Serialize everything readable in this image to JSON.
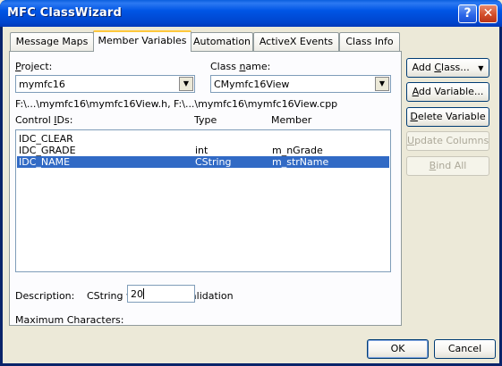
{
  "window": {
    "title": "MFC ClassWizard",
    "help_glyph": "?",
    "close_glyph": "✕"
  },
  "tabs": [
    {
      "label": "Message Maps"
    },
    {
      "label": "Member Variables"
    },
    {
      "label": "Automation"
    },
    {
      "label": "ActiveX Events"
    },
    {
      "label": "Class Info"
    }
  ],
  "project": {
    "label_pre": "",
    "label_u": "P",
    "label_post": "roject:",
    "value": "mymfc16"
  },
  "classname": {
    "label_pre": "Class ",
    "label_u": "n",
    "label_post": "ame:",
    "value": "CMymfc16View"
  },
  "files_path": "F:\\...\\mymfc16\\mymfc16View.h, F:\\...\\mymfc16\\mymfc16View.cpp",
  "list": {
    "headers": {
      "col1_pre": "Control ",
      "col1_u": "I",
      "col1_post": "Ds:",
      "col2": "Type",
      "col3": "Member"
    },
    "rows": [
      {
        "id": "IDC_CLEAR",
        "type": "",
        "member": ""
      },
      {
        "id": "IDC_GRADE",
        "type": "int",
        "member": "m_nGrade"
      },
      {
        "id": "IDC_NAME",
        "type": "CString",
        "member": "m_strName"
      }
    ],
    "selected_index": 2
  },
  "description": {
    "label": "Description:",
    "value": "CString with length validation"
  },
  "max_chars": {
    "label": "Maximum Characters:",
    "value": "20"
  },
  "buttons": {
    "add_class_pre": "Add ",
    "add_class_u": "C",
    "add_class_post": "lass...",
    "add_class_arrow": "▼",
    "add_variable_pre": "",
    "add_variable_u": "A",
    "add_variable_post": "dd Variable...",
    "delete_variable_pre": "",
    "delete_variable_u": "D",
    "delete_variable_post": "elete Variable",
    "update_columns_pre": "",
    "update_columns_u": "U",
    "update_columns_post": "pdate Columns",
    "bind_all_pre": "",
    "bind_all_u": "B",
    "bind_all_post": "ind All",
    "ok": "OK",
    "cancel": "Cancel"
  }
}
